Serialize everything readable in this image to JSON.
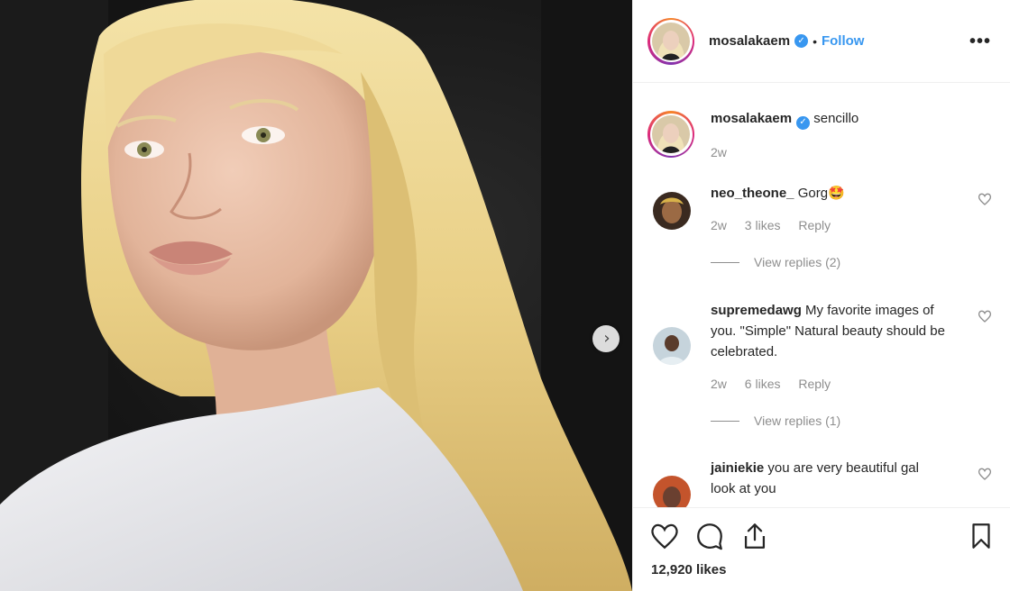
{
  "post": {
    "author": "mosalakaem",
    "follow_label": "Follow",
    "separator": "•",
    "more_label": "•••",
    "caption": "sencillo",
    "caption_time": "2w",
    "likes_count": "12,920 likes"
  },
  "comments": [
    {
      "username": "neo_theone_",
      "text": "Gorg🤩",
      "time": "2w",
      "likes": "3 likes",
      "reply_label": "Reply",
      "view_replies": "View replies (2)"
    },
    {
      "username": "supremedawg",
      "text": "My favorite images of you. \"Simple\" Natural beauty should be celebrated.",
      "time": "2w",
      "likes": "6 likes",
      "reply_label": "Reply",
      "view_replies": "View replies (1)"
    },
    {
      "username": "jainiekie",
      "text": "you are very beautiful gal look at you"
    }
  ],
  "icons": {
    "next": "chevron-right-icon",
    "like": "heart-icon",
    "comment": "comment-icon",
    "share": "share-icon",
    "save": "bookmark-icon",
    "verified": "verified-badge-icon"
  },
  "colors": {
    "accent": "#3897f0",
    "text": "#262626",
    "muted": "#8e8e8e",
    "border": "#efefef"
  }
}
